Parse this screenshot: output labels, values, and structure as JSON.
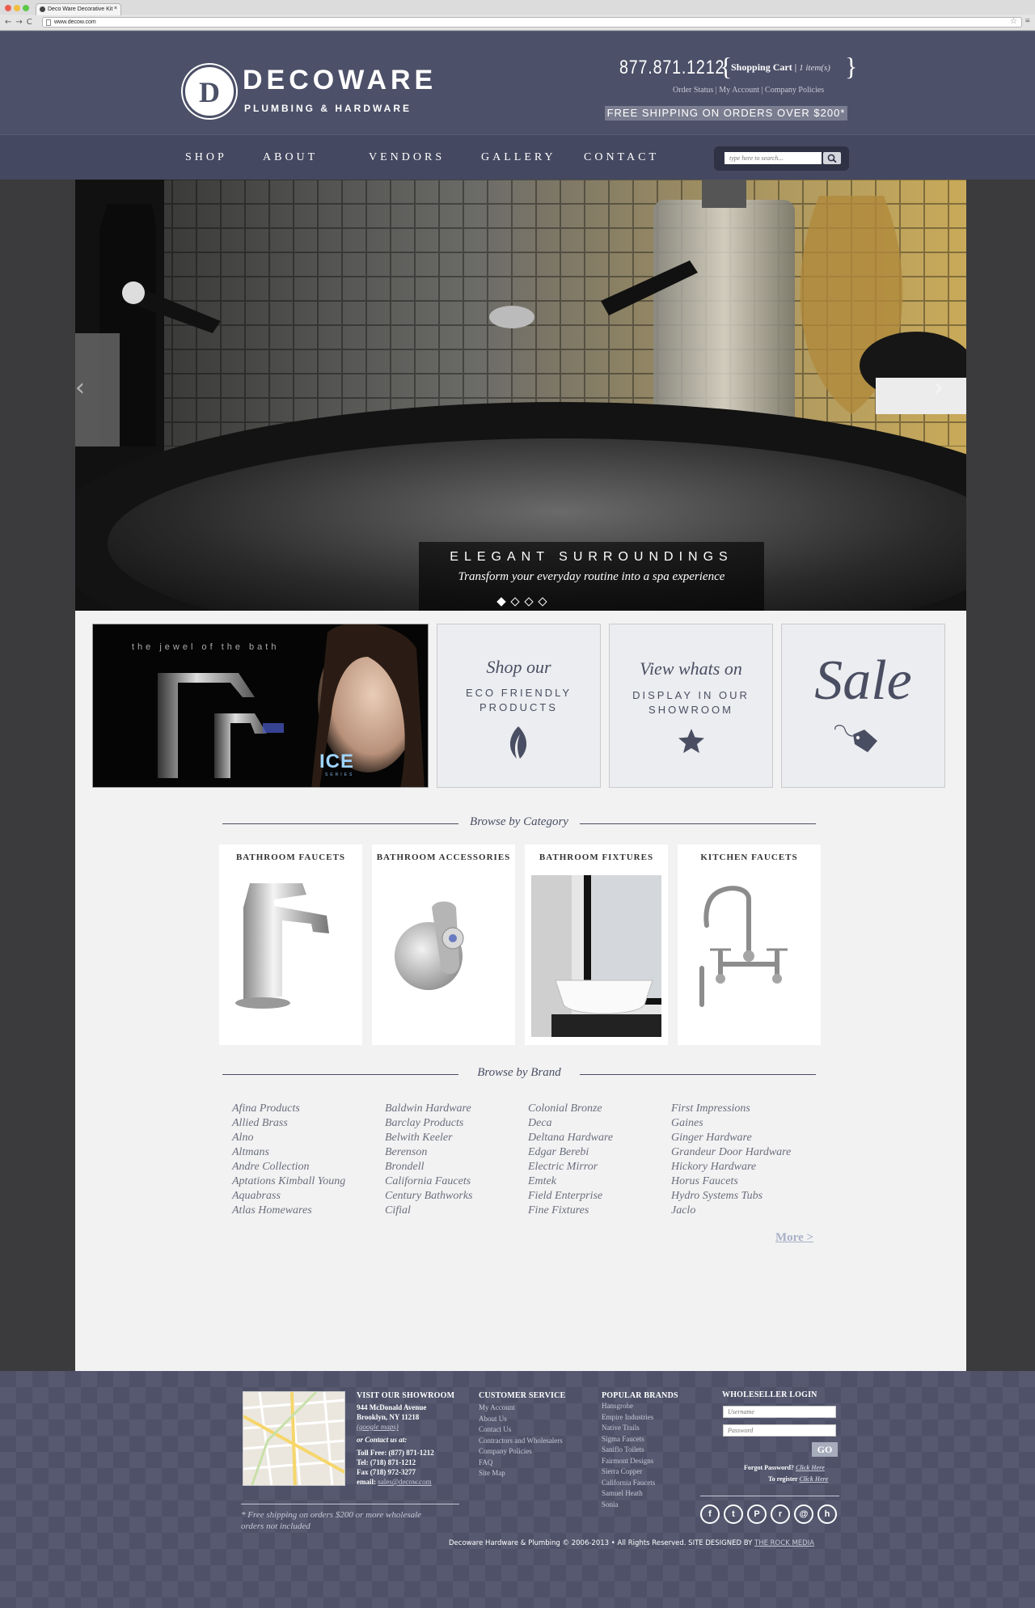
{
  "browser": {
    "tab_title": "Deco Ware Decorative Kit",
    "tab_close": "×",
    "nav_icons": "←→C",
    "url": "www.decow.com"
  },
  "header": {
    "logo_letter": "D",
    "logo_name": "DECOWARE",
    "logo_sub": "PLUMBING & HARDWARE",
    "phone": "877.871.1212",
    "brace_open": "{",
    "brace_close": "}",
    "cart_label": "Shopping Cart",
    "cart_sep": "|",
    "cart_items": "1 item(s)",
    "links": [
      "Order Status",
      "My Account",
      "Company Policies"
    ],
    "link_sep": " | ",
    "free_shipping": "FREE SHIPPING ON ORDERS OVER $200*"
  },
  "nav": {
    "items": [
      "SHOP",
      "ABOUT",
      "VENDORS",
      "GALLERY",
      "CONTACT"
    ],
    "search_placeholder": "type here to search..."
  },
  "hero": {
    "title": "ELEGANT SURROUNDINGS",
    "subtitle": "Transform your everyday routine into a spa experience",
    "slide_count": 4,
    "active_slide": 1
  },
  "promos": {
    "ice_tagline": "the jewel of the bath",
    "ice_logo": "ICE",
    "ice_series": "SERIES",
    "eco_script": "Shop our",
    "eco_caps_1": "ECO FRIENDLY",
    "eco_caps_2": "PRODUCTS",
    "showroom_script": "View whats on",
    "showroom_caps_1": "DISPLAY IN OUR",
    "showroom_caps_2": "SHOWROOM",
    "sale": "Sale"
  },
  "categories": {
    "heading": "Browse by Category",
    "items": [
      "BATHROOM FAUCETS",
      "BATHROOM ACCESSORIES",
      "BATHROOM FIXTURES",
      "KITCHEN FAUCETS"
    ]
  },
  "brands": {
    "heading": "Browse by Brand",
    "columns": [
      [
        "Afina Products",
        "Allied Brass",
        "Alno",
        "Altmans",
        "Andre Collection",
        "Aptations Kimball Young",
        "Aquabrass",
        "Atlas Homewares"
      ],
      [
        "Baldwin Hardware",
        "Barclay Products",
        "Belwith Keeler",
        "Berenson",
        "Brondell",
        "California Faucets",
        "Century Bathworks",
        "Cifial"
      ],
      [
        "Colonial Bronze",
        "Deca",
        "Deltana Hardware",
        "Edgar Berebi",
        "Electric Mirror",
        "Emtek",
        "Field Enterprise",
        "Fine Fixtures"
      ],
      [
        "First Impressions",
        "Gaines",
        "Ginger Hardware",
        "Grandeur Door Hardware",
        "Hickory Hardware",
        "Horus Faucets",
        "Hydro Systems Tubs",
        "Jaclo"
      ]
    ],
    "more": "More >"
  },
  "footer": {
    "showroom": {
      "heading": "VISIT OUR SHOWROOM",
      "address_1": "944 McDonald Avenue",
      "address_2": "Brooklyn, NY 11218",
      "maps_link": "(google maps)",
      "contact_label": "or Contact us at:",
      "toll_free": "Toll Free: (877) 871-1212",
      "tel": "Tel: (718) 871-1212",
      "fax": "Fax (718) 972-3277",
      "email_label": "email:",
      "email": "sales@decow.com"
    },
    "shipping_note_1": "*  Free shipping on orders $200 or more wholesale",
    "shipping_note_2": "orders not included",
    "customer_service": {
      "heading": "CUSTOMER SERVICE",
      "links": [
        "My Account",
        "About Us",
        "Contact Us",
        "Contractors and Wholesalers",
        "Company Policies",
        "FAQ",
        "Site Map"
      ]
    },
    "popular_brands": {
      "heading": "POPULAR BRANDS",
      "links": [
        "Hansgrohe",
        "Empire Industries",
        "Native Trails",
        "Sigma Faucets",
        "Saniflo Toilets",
        "Fairmont Designs",
        "Sierra Copper",
        "California Faucets",
        "Samuel Heath",
        "Sonia"
      ]
    },
    "wholesale": {
      "heading": "WHOLESELLER LOGIN",
      "username_placeholder": "Username",
      "password_placeholder": "Password",
      "go": "GO",
      "forgot_label": "Forgot Password?",
      "forgot_link": "Click Here",
      "register_label": "To register",
      "register_link": "Click Here"
    },
    "social_icons": [
      "facebook-icon",
      "twitter-icon",
      "pinterest-icon",
      "rss-icon",
      "email-icon",
      "houzz-icon"
    ],
    "social_glyphs": [
      "f",
      "t",
      "P",
      "r",
      "@",
      "h"
    ],
    "copyright": "Decoware Hardware & Plumbing © 2006-2013 • All Rights Reserved. SITE DESIGNED BY",
    "designer": "THE ROCK MEDIA"
  },
  "colors": {
    "header": "#4c5068",
    "nav": "#444860",
    "page_bg": "#3b3b3e",
    "content_bg": "#f2f2f3",
    "accent_text": "#4a4e62"
  }
}
